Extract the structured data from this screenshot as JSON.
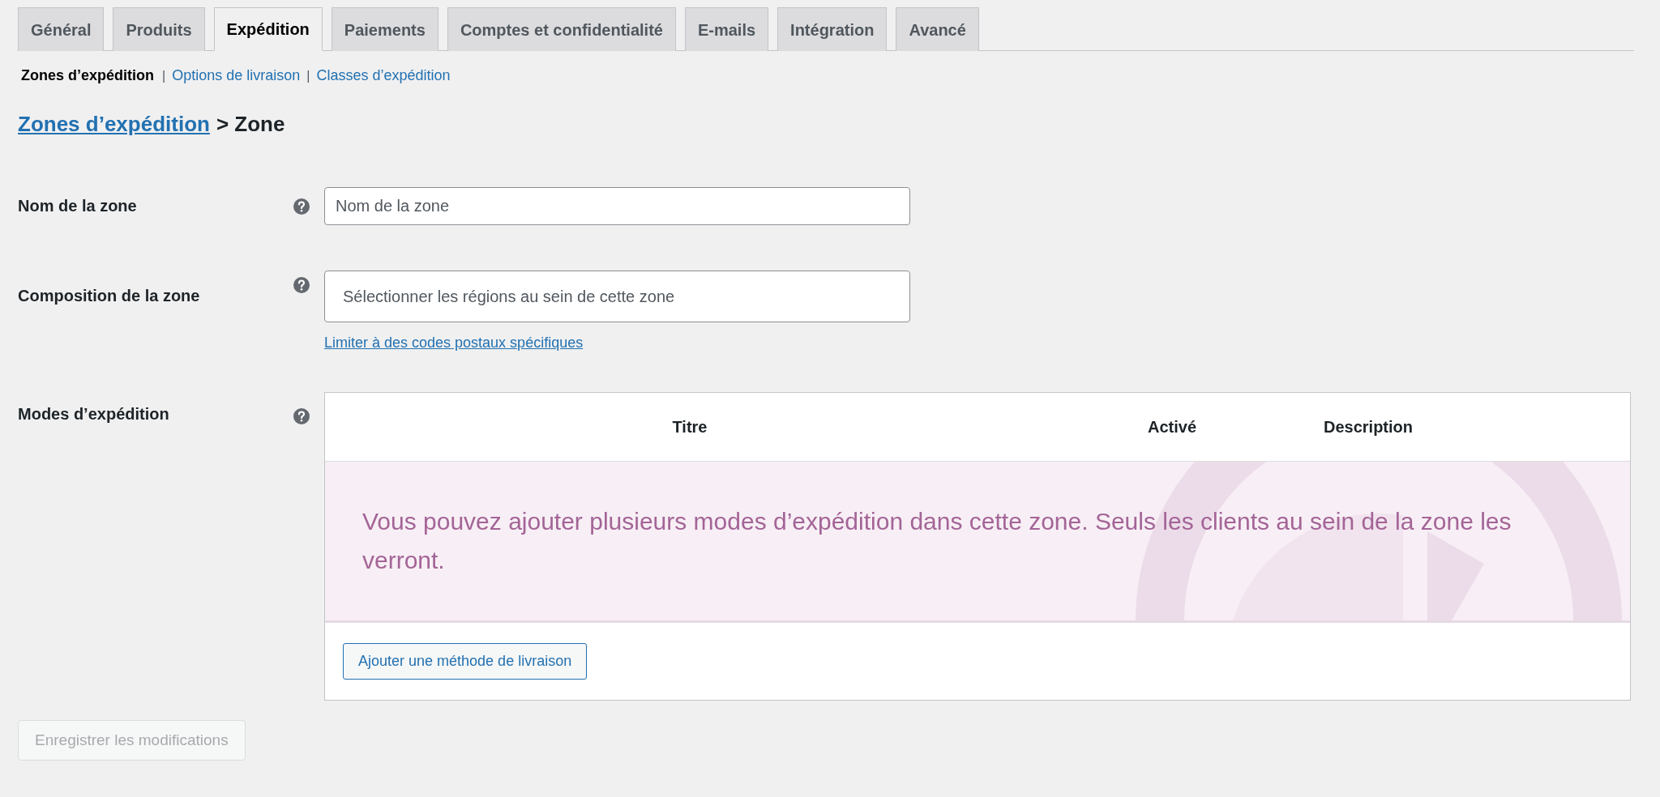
{
  "tabs": [
    {
      "label": "Général",
      "selected": false
    },
    {
      "label": "Produits",
      "selected": false
    },
    {
      "label": "Expédition",
      "selected": true
    },
    {
      "label": "Paiements",
      "selected": false
    },
    {
      "label": "Comptes et confidentialité",
      "selected": false
    },
    {
      "label": "E-mails",
      "selected": false
    },
    {
      "label": "Intégration",
      "selected": false
    },
    {
      "label": "Avancé",
      "selected": false
    }
  ],
  "subnav": [
    {
      "label": "Zones d’expédition",
      "selected": true
    },
    {
      "separator": "|",
      "label": "Options de livraison",
      "selected": false
    },
    {
      "separator": "|",
      "label": "Classes d’expédition",
      "selected": false
    }
  ],
  "breadcrumb": {
    "link": "Zones d’expédition",
    "current": "> Zone"
  },
  "form": {
    "rows": [
      {
        "kind": "text",
        "label": "Nom de la zone",
        "placeholder": "Nom de la zone"
      },
      {
        "kind": "select",
        "label": "Composition de la zone",
        "placeholder": "Sélectionner les régions au sein de cette zone",
        "link": "Limiter à des codes postaux spécifiques"
      },
      {
        "kind": "methods",
        "label": "Modes d’expédition"
      }
    ]
  },
  "methods_table": {
    "columns": [
      "Titre",
      "Activé",
      "Description"
    ],
    "empty_message": "Vous pouvez ajouter plusieurs modes d’expédition dans cette zone. Seuls les clients au sein de la zone les verront.",
    "add_button": "Ajouter une méthode de livraison"
  },
  "save_button": {
    "label": "Enregistrer les modifications",
    "disabled": true
  }
}
